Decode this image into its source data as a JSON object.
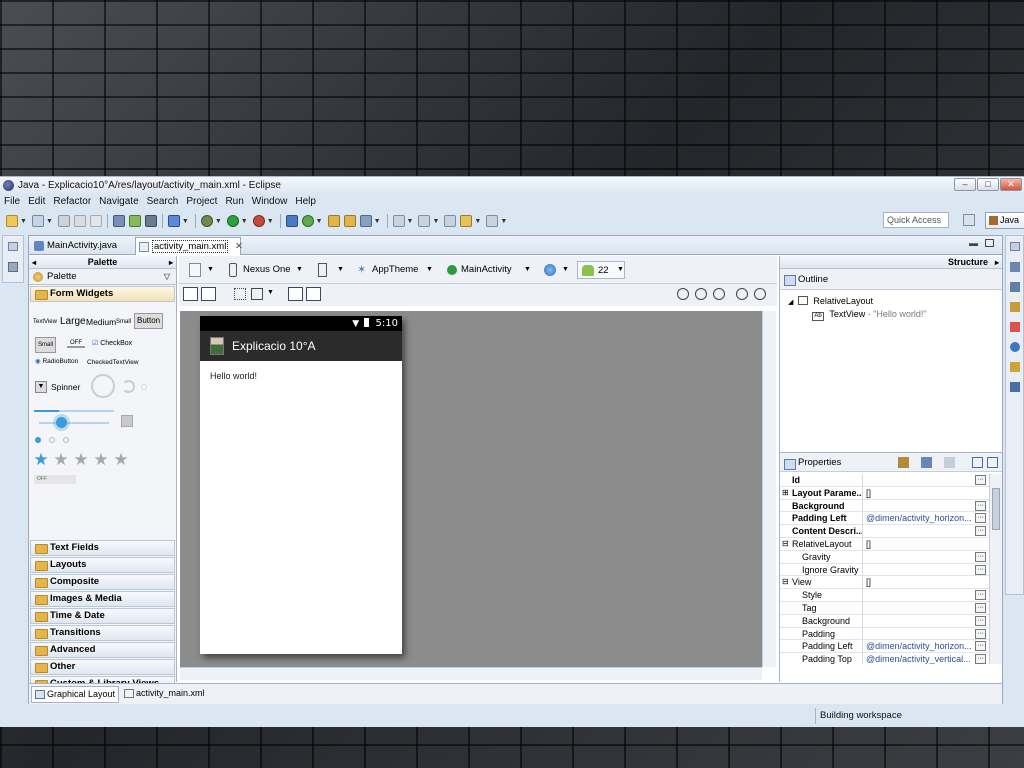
{
  "window": {
    "title": "Java - Explicacio10°A/res/layout/activity_main.xml - Eclipse",
    "minimize": "–",
    "maximize": "□",
    "close": "✕"
  },
  "menu": [
    "File",
    "Edit",
    "Refactor",
    "Navigate",
    "Search",
    "Project",
    "Run",
    "Window",
    "Help"
  ],
  "toolbar": {
    "quick_access_placeholder": "Quick Access",
    "perspective": "Java"
  },
  "editor_tabs": [
    {
      "label": "MainActivity.java"
    },
    {
      "label": "activity_main.xml",
      "close": "✕"
    }
  ],
  "palette": {
    "header": "Palette",
    "sub": "Palette",
    "current_category": "Form Widgets",
    "widgets": {
      "textview": "TextView",
      "large": "Large",
      "medium": "Medium",
      "small": "Small",
      "button": "Button",
      "small_button": "Small",
      "toggle_off": "OFF",
      "checkbox": "CheckBox",
      "radiobutton": "RadioButton",
      "checkedtextview": "CheckedTextView",
      "spinner": "Spinner",
      "switch_off": "OFF"
    },
    "categories": [
      "Text Fields",
      "Layouts",
      "Composite",
      "Images & Media",
      "Time & Date",
      "Transitions",
      "Advanced",
      "Other",
      "Custom & Library Views"
    ]
  },
  "canvas_toolbar": {
    "device": "Nexus One",
    "theme": "AppTheme",
    "activity": "MainActivity",
    "api": "22"
  },
  "device": {
    "time": "5:10",
    "app_title": "Explicacio 10°A",
    "hello_text": "Hello world!"
  },
  "bottom_tabs": [
    "Graphical Layout",
    "activity_main.xml"
  ],
  "structure": {
    "header": "Structure",
    "outline_title": "Outline",
    "tree": [
      {
        "label": "RelativeLayout"
      },
      {
        "label": "TextView",
        "detail": " - \"Hello world!\""
      }
    ]
  },
  "properties": {
    "title": "Properties",
    "rows": [
      {
        "name": "Id",
        "value": "",
        "bold": true,
        "button": true
      },
      {
        "name": "Layout Parame...",
        "value": "[]",
        "bold": true,
        "expand": "⊞"
      },
      {
        "name": "Background",
        "value": "",
        "bold": true,
        "button": true
      },
      {
        "name": "Padding Left",
        "value": "@dimen/activity_horizon...",
        "bold": true,
        "button": true
      },
      {
        "name": "Content Descri...",
        "value": "",
        "bold": true,
        "button": true
      },
      {
        "name": "RelativeLayout",
        "value": "[]",
        "bold": false,
        "expand": "⊟"
      },
      {
        "name": "Gravity",
        "value": "",
        "bold": false,
        "button": true,
        "indent": true
      },
      {
        "name": "Ignore Gravity",
        "value": "",
        "bold": false,
        "button": true,
        "indent": true
      },
      {
        "name": "View",
        "value": "[]",
        "bold": false,
        "expand": "⊟"
      },
      {
        "name": "Style",
        "value": "",
        "bold": false,
        "button": true,
        "indent": true
      },
      {
        "name": "Tag",
        "value": "",
        "bold": false,
        "button": true,
        "indent": true
      },
      {
        "name": "Background",
        "value": "",
        "bold": false,
        "button": true,
        "indent": true
      },
      {
        "name": "Padding",
        "value": "",
        "bold": false,
        "button": true,
        "indent": true
      },
      {
        "name": "Padding Left",
        "value": "@dimen/activity_horizon...",
        "bold": false,
        "button": true,
        "indent": true
      },
      {
        "name": "Padding Top",
        "value": "@dimen/activity_vertical...",
        "bold": false,
        "button": true,
        "indent": true
      }
    ]
  },
  "status": {
    "text": "Building workspace"
  },
  "colors": {
    "accent_star": "#3c9ad8",
    "android_green": "#8bc34a"
  }
}
